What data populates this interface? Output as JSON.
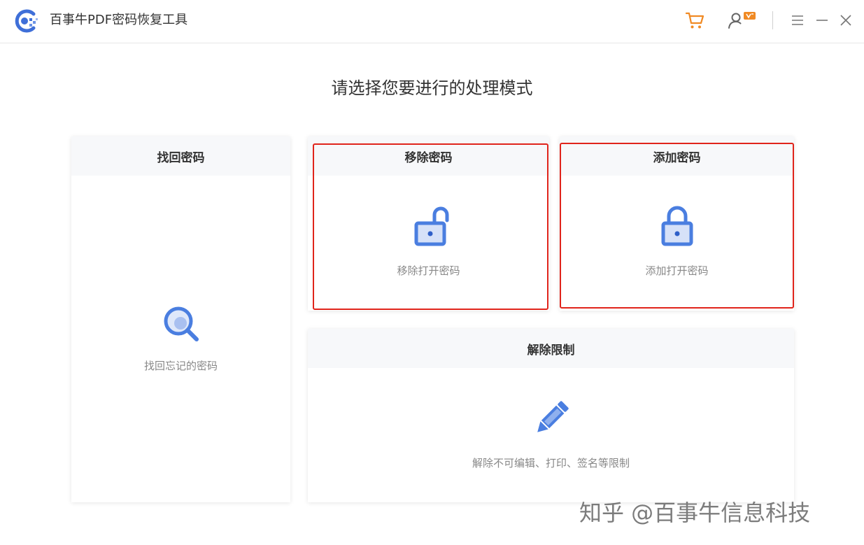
{
  "app": {
    "title": "百事牛PDF密码恢复工具",
    "logo_icon": "bsn-logo-icon"
  },
  "toolbar": {
    "cart_icon": "shopping-cart-icon",
    "account_icon": "user-account-icon",
    "menu_icon": "menu-icon",
    "minimize_icon": "minimize-icon",
    "close_icon": "close-icon"
  },
  "heading": "请选择您要进行的处理模式",
  "cards": {
    "recover": {
      "title": "找回密码",
      "desc": "找回忘记的密码",
      "icon": "magnifier-icon"
    },
    "remove": {
      "title": "移除密码",
      "desc": "移除打开密码",
      "icon": "unlocked-padlock-icon"
    },
    "add": {
      "title": "添加密码",
      "desc": "添加打开密码",
      "icon": "locked-padlock-icon"
    },
    "restrict": {
      "title": "解除限制",
      "desc": "解除不可编辑、打印、签名等限制",
      "icon": "pencil-icon"
    }
  },
  "watermark": "知乎 @百事牛信息科技",
  "colors": {
    "accent_blue": "#4a7ee0",
    "cart_orange": "#f08a24",
    "highlight_red": "#e0241b"
  }
}
